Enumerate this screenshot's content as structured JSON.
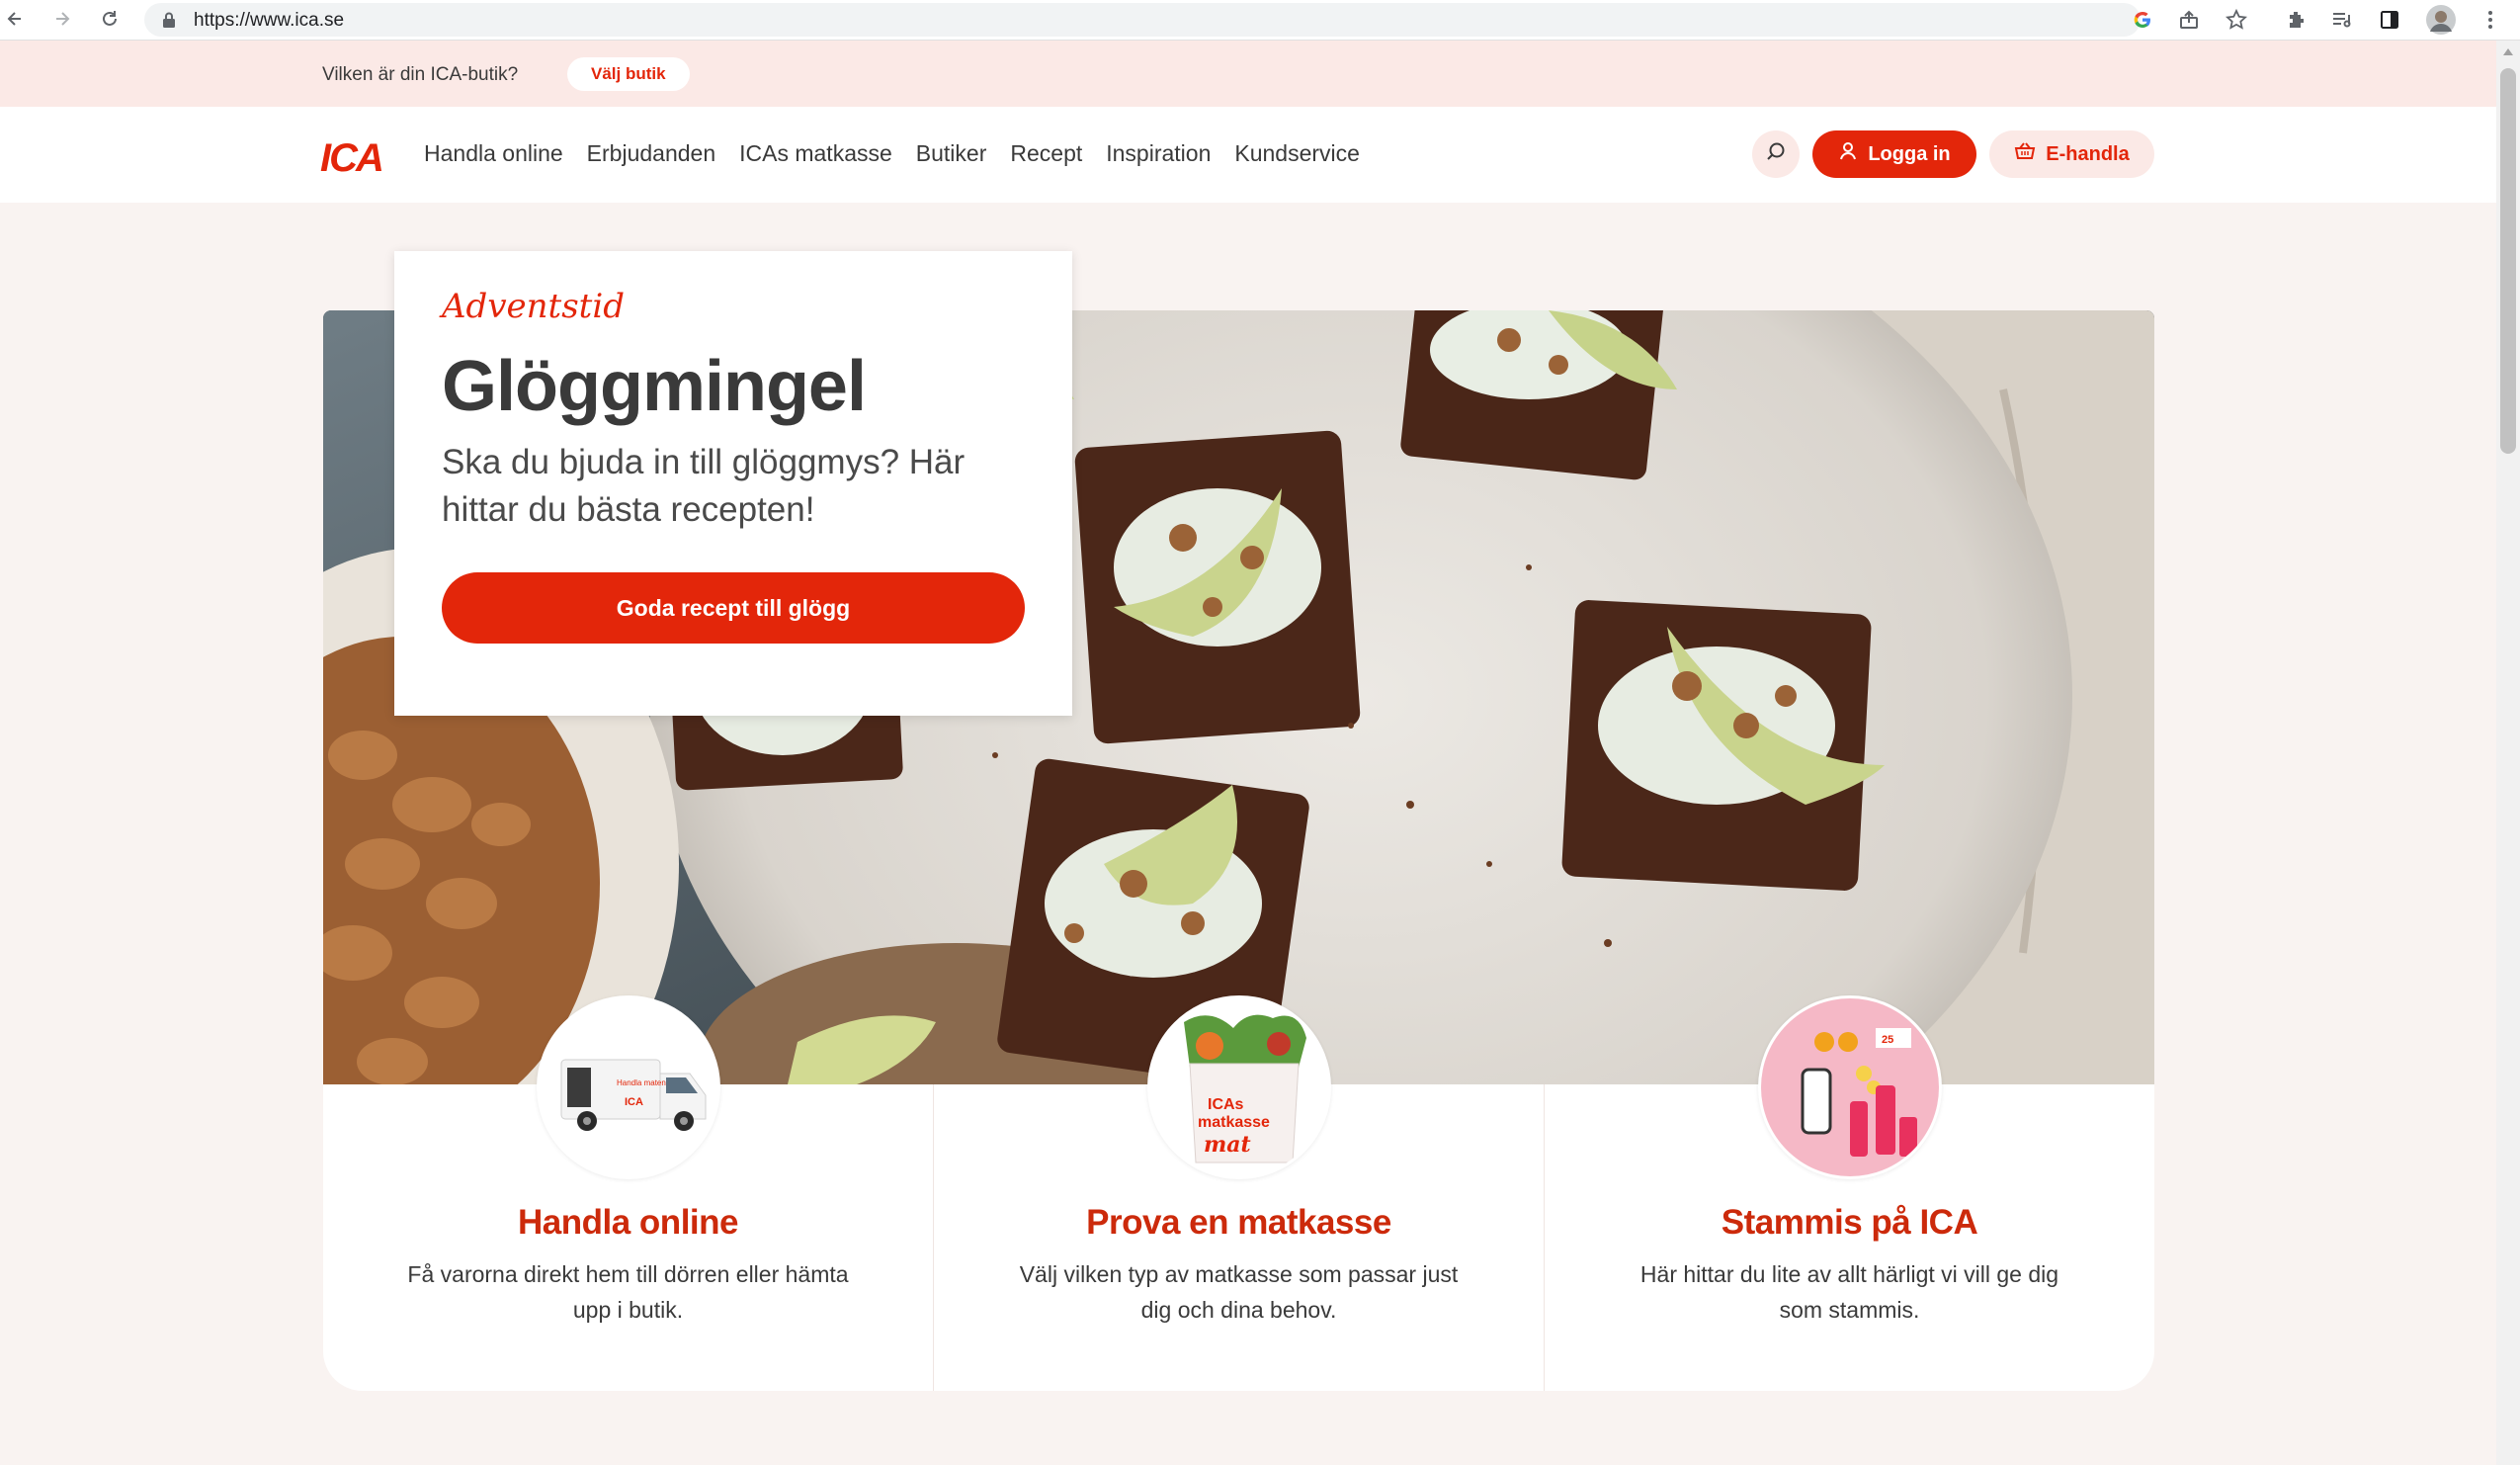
{
  "browser": {
    "url": "https://www.ica.se"
  },
  "storebar": {
    "question": "Vilken är din ICA-butik?",
    "choose_label": "Välj butik"
  },
  "header": {
    "logo_text": "ICA",
    "nav": [
      "Handla online",
      "Erbjudanden",
      "ICAs matkasse",
      "Butiker",
      "Recept",
      "Inspiration",
      "Kundservice"
    ],
    "login_label": "Logga in",
    "ehandla_label": "E-handla"
  },
  "hero": {
    "kicker": "Adventstid",
    "title": "Glöggmingel",
    "subtitle": "Ska du bjuda in till glöggmys? Här hittar du bästa recepten!",
    "cta_label": "Goda recept till glögg"
  },
  "features": [
    {
      "title": "Handla online",
      "description": "Få varorna direkt hem till dörren eller hämta upp i butik."
    },
    {
      "title": "Prova en matkasse",
      "description": "Välj vilken typ av matkasse som passar just dig och dina behov."
    },
    {
      "title": "Stammis på ICA",
      "description": "Här hittar du lite av allt härligt vi vill ge dig som stammis."
    }
  ],
  "colors": {
    "brand_red": "#e3260a",
    "store_bar_bg": "#fbe9e6",
    "page_bg": "#f9f3f1"
  },
  "icons": [
    "back-arrow-icon",
    "forward-arrow-icon",
    "reload-icon",
    "lock-icon",
    "google-icon",
    "share-icon",
    "star-icon",
    "extensions-icon",
    "reading-list-icon",
    "side-panel-icon",
    "profile-avatar",
    "menu-dots-icon",
    "search-icon",
    "user-icon",
    "basket-icon"
  ]
}
